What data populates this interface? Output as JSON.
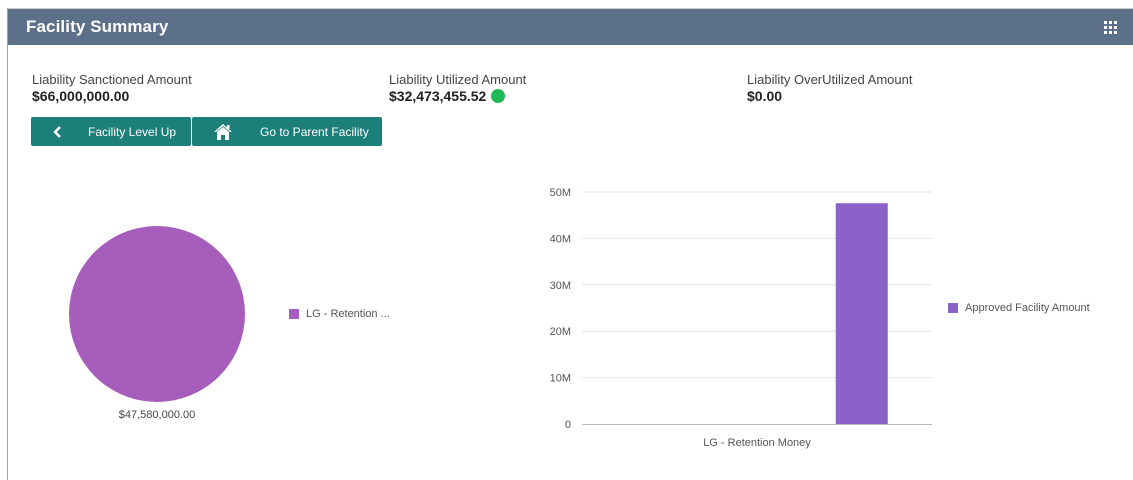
{
  "header": {
    "title": "Facility Summary",
    "menu_icon": "grid-icon",
    "background_color": "#5c7089"
  },
  "metrics": {
    "sanctioned": {
      "label": "Liability Sanctioned Amount",
      "value": "$66,000,000.00"
    },
    "utilized": {
      "label": "Liability Utilized Amount",
      "value": "$32,473,455.52",
      "status_color": "#1db954"
    },
    "overutilized": {
      "label": "Liability OverUtilized Amount",
      "value": "$0.00"
    }
  },
  "buttons": {
    "level_up": {
      "label": "Facility Level Up",
      "icon": "chevron-left-icon"
    },
    "parent": {
      "label": "Go to Parent Facility",
      "icon": "home-icon"
    },
    "color": "#1d7f7a"
  },
  "pie_chart": {
    "type": "pie",
    "legend": "LG - Retention ...",
    "value_label": "$47,580,000.00",
    "slices": [
      {
        "name": "LG - Retention ...",
        "value": 47580000
      }
    ],
    "color": "#a65dbb"
  },
  "chart_data": {
    "type": "bar",
    "categories": [
      "LG - Retention Money"
    ],
    "series": [
      {
        "name": "Approved Facility Amount",
        "values": [
          47580000
        ]
      }
    ],
    "y_ticks": [
      "0",
      "10M",
      "20M",
      "30M",
      "40M",
      "50M"
    ],
    "ylim": [
      0,
      50000000
    ],
    "grid": true,
    "legend": "right",
    "color": "#8a62c8"
  }
}
